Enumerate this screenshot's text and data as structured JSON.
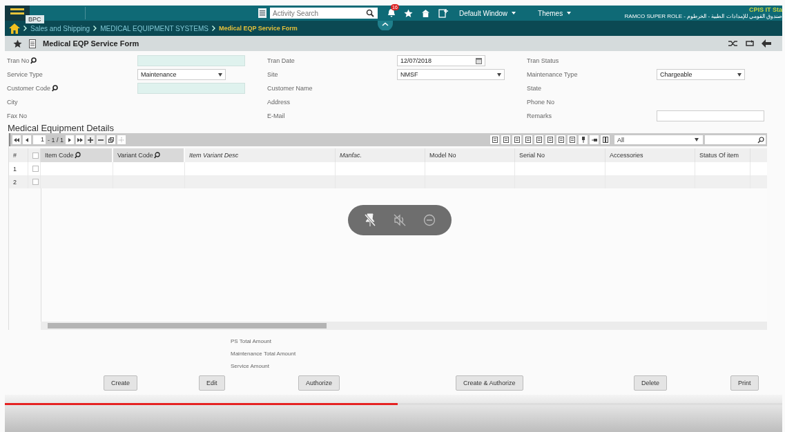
{
  "top_bar": {
    "menu_tooltip": "BPC",
    "activity_search": {
      "placeholder": "Activity Search"
    },
    "notification_count": "16",
    "window_menu": "Default Window",
    "themes_menu": "Themes",
    "user_title": "CPIS IT Sta",
    "role": "صندوق القومي للإمدادات الطبية - الخرطوم - RAMCO SUPER ROLE"
  },
  "breadcrumb": [
    {
      "label": "Sales and Shipping",
      "current": false
    },
    {
      "label": "MEDICAL EQUIPMENT SYSTEMS",
      "current": false
    },
    {
      "label": "Medical  EQP Service Form",
      "current": true
    }
  ],
  "form_title": "Medical  EQP Service Form",
  "fields": [
    {
      "label": "Tran No",
      "lookup": true,
      "kind": "lookup"
    },
    {
      "label": "Tran Date",
      "lookup": false,
      "kind": "date",
      "value": "12/07/2018"
    },
    {
      "label": "Tran Status",
      "lookup": false,
      "kind": "none"
    },
    {
      "label": "Service Type",
      "lookup": false,
      "kind": "select",
      "value": "Maintenance"
    },
    {
      "label": "Site",
      "lookup": false,
      "kind": "select",
      "value": "NMSF"
    },
    {
      "label": "Maintenance Type",
      "lookup": false,
      "kind": "select",
      "value": "Chargeable"
    },
    {
      "label": "Customer Code",
      "lookup": true,
      "kind": "lookup"
    },
    {
      "label": "Customer Name",
      "lookup": false,
      "kind": "none"
    },
    {
      "label": "State",
      "lookup": false,
      "kind": "none"
    },
    {
      "label": "City",
      "lookup": false,
      "kind": "none"
    },
    {
      "label": "Address",
      "lookup": false,
      "kind": "none"
    },
    {
      "label": "Phone No",
      "lookup": false,
      "kind": "none"
    },
    {
      "label": "Fax No",
      "lookup": false,
      "kind": "none"
    },
    {
      "label": "E-Mail",
      "lookup": false,
      "kind": "none"
    },
    {
      "label": "Remarks",
      "lookup": false,
      "kind": "text"
    }
  ],
  "grid": {
    "title": "Medical Equipment Details",
    "page": "1",
    "page_info": "- 1 / 1",
    "filter": "All",
    "columns": [
      {
        "label": "#",
        "kind": "plain"
      },
      {
        "kind": "checkbox",
        "checked": false
      },
      {
        "label": "Item Code",
        "kind": "lookup"
      },
      {
        "label": "Variant Code",
        "kind": "lookup"
      },
      {
        "label": "Item Variant Desc",
        "kind": "italic"
      },
      {
        "label": "Manfac.",
        "kind": "italic"
      },
      {
        "label": "Model No",
        "kind": "plain"
      },
      {
        "label": "Serial No",
        "kind": "plain"
      },
      {
        "label": "Accessories",
        "kind": "plain"
      },
      {
        "label": "Status Of item",
        "kind": "plain"
      }
    ],
    "rows": [
      {
        "number": "1",
        "checked": false
      },
      {
        "number": "2",
        "checked": false
      }
    ]
  },
  "totals": [
    "PS Total Amount",
    "Maintenance Total Amount",
    "Service Amount"
  ],
  "buttons": [
    "Create",
    "Edit",
    "Authorize",
    "Create & Authorize",
    "Delete",
    "Print"
  ],
  "video": {
    "progress": {
      "level": 0.505
    }
  }
}
